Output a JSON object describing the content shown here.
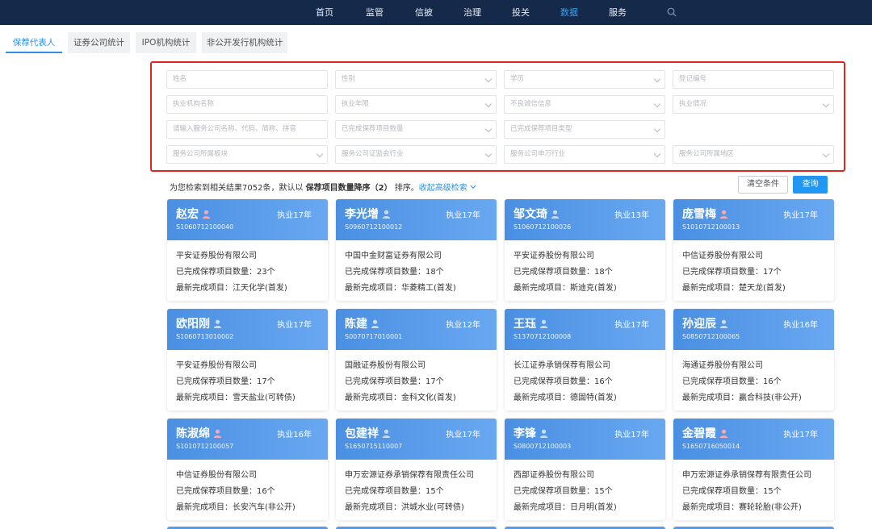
{
  "nav": {
    "items": [
      "首页",
      "监管",
      "信披",
      "治理",
      "投关",
      "数据",
      "服务"
    ],
    "active_index": 5,
    "active_color": "#3aa0f0",
    "bg_color": "#15294a",
    "search_icon": "search-icon"
  },
  "tabs": [
    "保荐代表人",
    "证券公司统计",
    "IPO机构统计",
    "非公开发行机构统计"
  ],
  "active_tab": 0,
  "filters": {
    "name": "姓名",
    "gender": "性别",
    "education": "学历",
    "reg_no": "登记编号",
    "org_name": "执业机构名称",
    "years": "执业年限",
    "integrity": "不良诚信信息",
    "status": "执业情况",
    "service_company": "请输入服务公司名称、代码、简称、拼音",
    "project_count": "已完成保荐项目数量",
    "project_type": "已完成保荐项目类型",
    "board": "服务公司所属板块",
    "csrc_industry": "服务公司证监会行业",
    "sw_industry": "服务公司申万行业",
    "region": "服务公司所属地区"
  },
  "result": {
    "prefix": "为您检索到相关结果7052条，默认以 ",
    "sort": "保荐项目数量降序（2）",
    "suffix": " 排序。",
    "advanced": "收起高级检索"
  },
  "buttons": {
    "clear": "清空条件",
    "query": "查询"
  },
  "card_labels": {
    "count": "已完成保荐项目数量：",
    "latest": "最新完成项目："
  },
  "cards": [
    {
      "name": "赵宏",
      "gender": "female",
      "years": "执业17年",
      "code": "S1060712100040",
      "company": "平安证券股份有限公司",
      "count": "23个",
      "latest": "江天化学(首发)"
    },
    {
      "name": "李光增",
      "gender": "male",
      "years": "执业17年",
      "code": "S0960712100012",
      "company": "中国中金财富证券有限公司",
      "count": "18个",
      "latest": "华菱精工(首发)"
    },
    {
      "name": "邹文琦",
      "gender": "male",
      "years": "执业13年",
      "code": "S1060712100026",
      "company": "平安证券股份有限公司",
      "count": "18个",
      "latest": "斯迪克(首发)"
    },
    {
      "name": "庞雪梅",
      "gender": "female",
      "years": "执业17年",
      "code": "S1010712100013",
      "company": "中信证券股份有限公司",
      "count": "17个",
      "latest": "楚天龙(首发)"
    },
    {
      "name": "欧阳刚",
      "gender": "male",
      "years": "执业17年",
      "code": "S1060713010002",
      "company": "平安证券股份有限公司",
      "count": "17个",
      "latest": "雪天盐业(可转债)"
    },
    {
      "name": "陈建",
      "gender": "male",
      "years": "执业12年",
      "code": "S0070717010001",
      "company": "国融证券股份有限公司",
      "count": "17个",
      "latest": "金科文化(首发)"
    },
    {
      "name": "王珏",
      "gender": "male",
      "years": "执业17年",
      "code": "S1370712100008",
      "company": "长江证券承销保荐有限公司",
      "count": "16个",
      "latest": "德固特(首发)"
    },
    {
      "name": "孙迎辰",
      "gender": "male",
      "years": "执业16年",
      "code": "S0850712100065",
      "company": "海通证券股份有限公司",
      "count": "16个",
      "latest": "赢合科技(非公开)"
    },
    {
      "name": "陈淑绵",
      "gender": "female",
      "years": "执业16年",
      "code": "S1010712100057",
      "company": "中信证券股份有限公司",
      "count": "16个",
      "latest": "长安汽车(非公开)"
    },
    {
      "name": "包建祥",
      "gender": "male",
      "years": "执业17年",
      "code": "S1650715110007",
      "company": "申万宏源证券承销保荐有限责任公司",
      "count": "15个",
      "latest": "洪城水业(可转债)"
    },
    {
      "name": "李锋",
      "gender": "male",
      "years": "执业17年",
      "code": "S0800712100003",
      "company": "西部证券股份有限公司",
      "count": "15个",
      "latest": "日月明(首发)"
    },
    {
      "name": "金碧霞",
      "gender": "female",
      "years": "执业17年",
      "code": "S1650716050014",
      "company": "申万宏源证券承销保荐有限责任公司",
      "count": "15个",
      "latest": "赛轮轮胎(非公开)"
    }
  ]
}
